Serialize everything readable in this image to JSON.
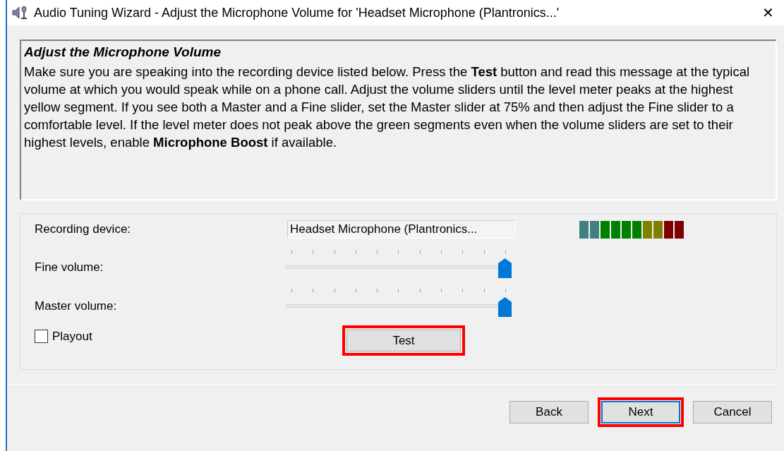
{
  "window": {
    "title": "Audio Tuning Wizard - Adjust the Microphone Volume for 'Headset Microphone (Plantronics...'",
    "close": "✕"
  },
  "instructions": {
    "heading": "Adjust the Microphone Volume",
    "body": "Make sure you are speaking into the recording device listed below. Press the **Test** button and read this message at the typical volume at which you would speak while on a phone call. Adjust the volume sliders until the level meter peaks at the highest yellow segment. If you see both a Master and a Fine slider, set the Master slider at 75% and then adjust the Fine slider to a comfortable level. If the level meter does not peak above the green segments even when the volume sliders are set to their highest levels, enable **Microphone Boost** if available."
  },
  "recording_device": {
    "label": "Recording device:",
    "value": "Headset Microphone (Plantronics..."
  },
  "meter": {
    "segments": [
      {
        "color": "#408080"
      },
      {
        "color": "#408080"
      },
      {
        "color": "#008000"
      },
      {
        "color": "#008000"
      },
      {
        "color": "#008000"
      },
      {
        "color": "#008000"
      },
      {
        "color": "#808000"
      },
      {
        "color": "#808000"
      },
      {
        "color": "#800000"
      },
      {
        "color": "#800000"
      }
    ]
  },
  "sliders": [
    {
      "label": "Fine volume:",
      "level": 1
    },
    {
      "label": "Master volume:",
      "level": 1
    }
  ],
  "playout": {
    "label": "Playout",
    "checked": false
  },
  "test_button": {
    "label": "Test",
    "highlighted": true
  },
  "buttons": [
    {
      "label": "Back",
      "highlighted": false,
      "selected": false
    },
    {
      "label": "Next",
      "highlighted": true,
      "selected": true
    },
    {
      "label": "Cancel",
      "highlighted": false,
      "selected": false
    }
  ]
}
